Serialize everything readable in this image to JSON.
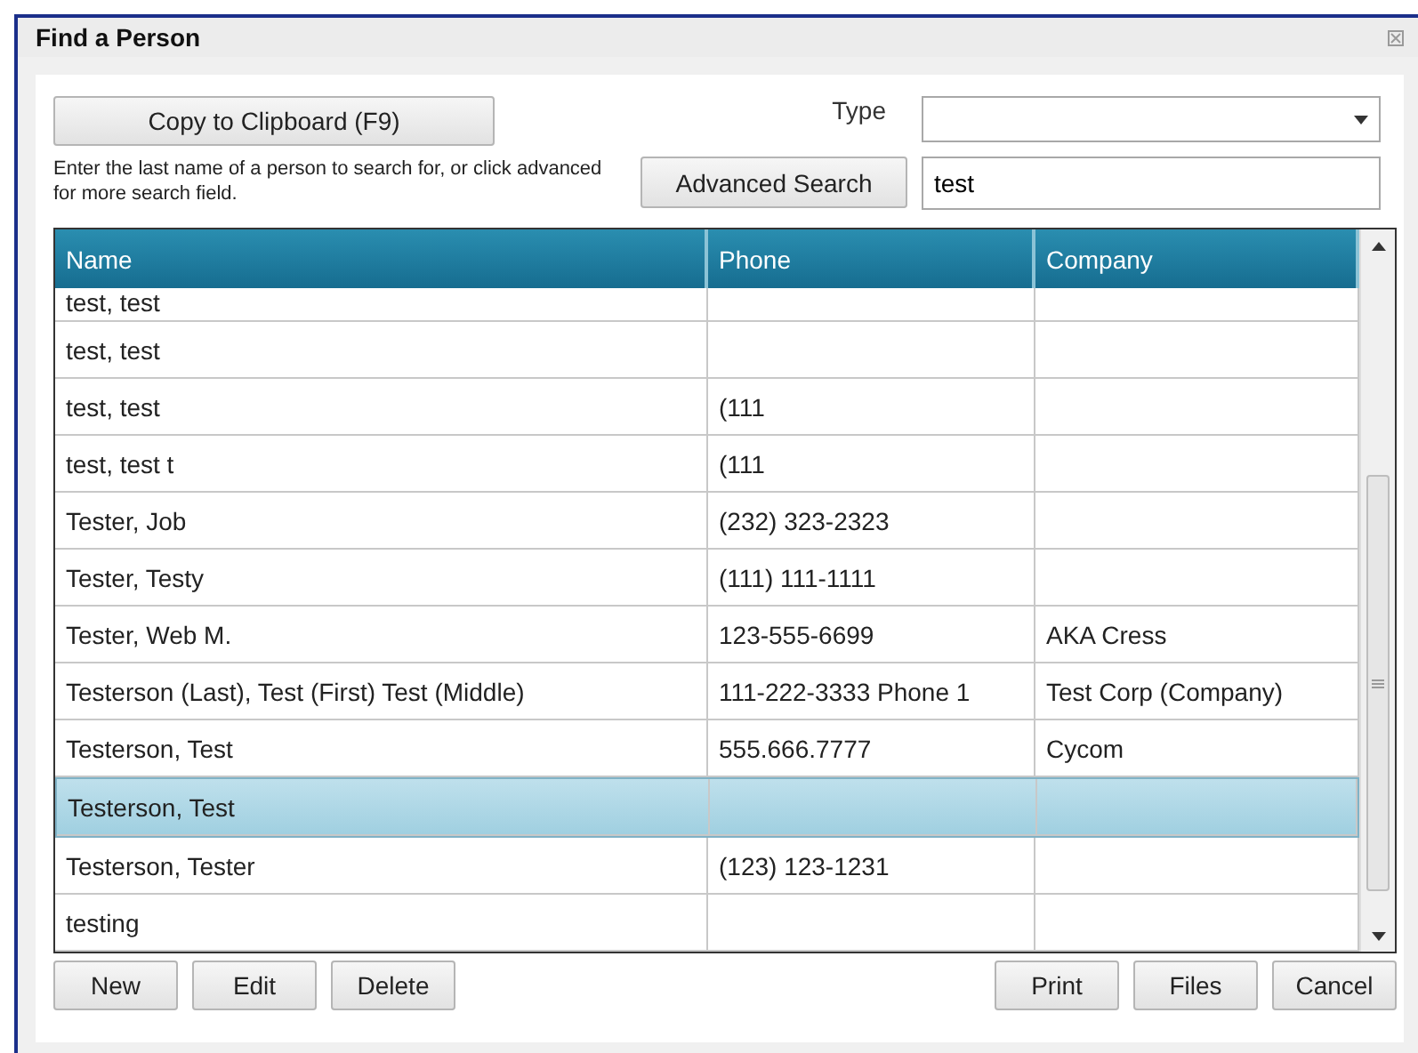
{
  "window": {
    "title": "Find a Person"
  },
  "copy_button": "Copy to Clipboard (F9)",
  "hint": "Enter the last name of a person to search for, or click advanced for more search field.",
  "advanced_button": "Advanced Search",
  "type_label": "Type",
  "search": {
    "value": "test"
  },
  "table": {
    "columns": [
      "Name",
      "Phone",
      "Company"
    ],
    "rows": [
      {
        "name": "test, test",
        "phone": "",
        "company": "",
        "selected": false
      },
      {
        "name": "test, test",
        "phone": "",
        "company": "",
        "selected": false
      },
      {
        "name": "test, test",
        "phone": "(111",
        "company": "",
        "selected": false
      },
      {
        "name": "test, test t",
        "phone": "(111",
        "company": "",
        "selected": false
      },
      {
        "name": "Tester, Job",
        "phone": "(232) 323-2323",
        "company": "",
        "selected": false
      },
      {
        "name": "Tester, Testy",
        "phone": "(111) 111-1111",
        "company": "",
        "selected": false
      },
      {
        "name": "Tester, Web M.",
        "phone": "123-555-6699",
        "company": "AKA Cress",
        "selected": false
      },
      {
        "name": "Testerson (Last), Test (First) Test (Middle)",
        "phone": "111-222-3333 Phone 1",
        "company": "Test Corp (Company)",
        "selected": false
      },
      {
        "name": "Testerson, Test",
        "phone": "555.666.7777",
        "company": "Cycom",
        "selected": false
      },
      {
        "name": "Testerson, Test",
        "phone": "",
        "company": "",
        "selected": true
      },
      {
        "name": "Testerson, Tester",
        "phone": "(123) 123-1231",
        "company": "",
        "selected": false
      },
      {
        "name": "testing",
        "phone": "",
        "company": "",
        "selected": false
      }
    ]
  },
  "left_buttons": [
    "New",
    "Edit",
    "Delete"
  ],
  "right_buttons": [
    "Print",
    "Files",
    "Cancel"
  ]
}
